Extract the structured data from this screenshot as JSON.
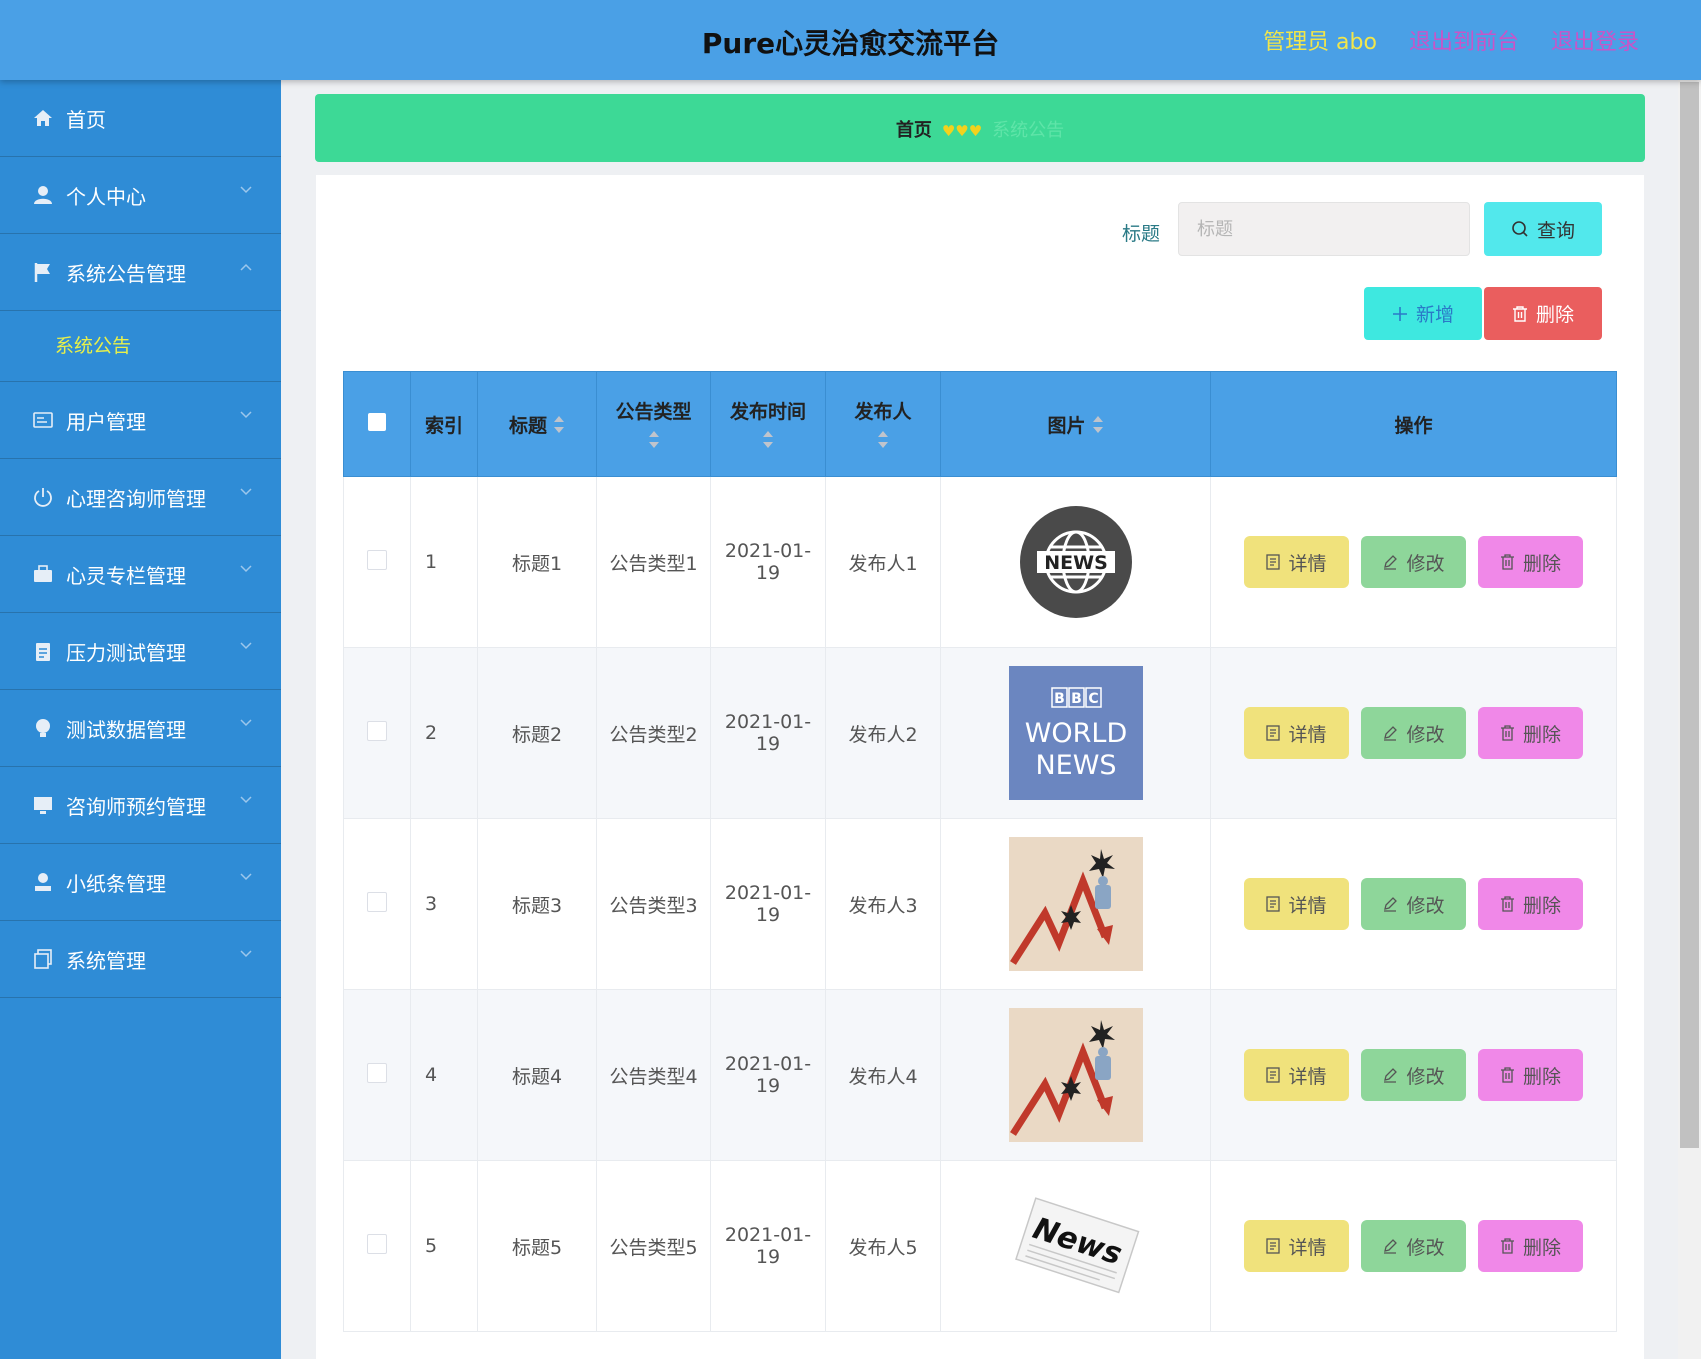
{
  "header": {
    "title": "Pure心灵治愈交流平台",
    "admin_label": "管理员 abo",
    "front_link": "退出到前台",
    "logout_link": "退出登录"
  },
  "sidebar": {
    "items": [
      {
        "label": "首页",
        "icon": "home-icon"
      },
      {
        "label": "个人中心",
        "icon": "user-icon"
      },
      {
        "label": "系统公告管理",
        "icon": "flag-icon",
        "expanded": true
      },
      {
        "label": "用户管理",
        "icon": "id-card-icon"
      },
      {
        "label": "心理咨询师管理",
        "icon": "power-icon"
      },
      {
        "label": "心灵专栏管理",
        "icon": "briefcase-icon"
      },
      {
        "label": "压力测试管理",
        "icon": "clipboard-icon"
      },
      {
        "label": "测试数据管理",
        "icon": "bulb-icon"
      },
      {
        "label": "咨询师预约管理",
        "icon": "monitor-icon"
      },
      {
        "label": "小纸条管理",
        "icon": "person-icon"
      },
      {
        "label": "系统管理",
        "icon": "copy-icon"
      }
    ],
    "sub_item": "系统公告"
  },
  "breadcrumb": {
    "home": "首页",
    "separator": "♥♥♥",
    "current": "系统公告"
  },
  "search": {
    "label": "标题",
    "placeholder": "标题",
    "query_button": "查询"
  },
  "actions": {
    "add_button": "新增",
    "delete_button": "删除"
  },
  "table": {
    "columns": [
      "索引",
      "标题",
      "公告类型",
      "发布时间",
      "发布人",
      "图片",
      "操作"
    ],
    "rows": [
      {
        "index": "1",
        "title": "标题1",
        "type": "公告类型1",
        "time_line1": "2021-01-",
        "time_line2": "19",
        "publisher": "发布人1",
        "image": "news-globe-image"
      },
      {
        "index": "2",
        "title": "标题2",
        "type": "公告类型2",
        "time_line1": "2021-01-",
        "time_line2": "19",
        "publisher": "发布人2",
        "image": "bbc-world-news-image"
      },
      {
        "index": "3",
        "title": "标题3",
        "type": "公告类型3",
        "time_line1": "2021-01-",
        "time_line2": "19",
        "publisher": "发布人3",
        "image": "falling-chart-image"
      },
      {
        "index": "4",
        "title": "标题4",
        "type": "公告类型4",
        "time_line1": "2021-01-",
        "time_line2": "19",
        "publisher": "发布人4",
        "image": "falling-chart-image"
      },
      {
        "index": "5",
        "title": "标题5",
        "type": "公告类型5",
        "time_line1": "2021-01-",
        "time_line2": "19",
        "publisher": "发布人5",
        "image": "newspaper-image"
      }
    ],
    "row_actions": {
      "detail": "详情",
      "edit": "修改",
      "delete": "删除"
    }
  },
  "colors": {
    "header_bg": "#4aa0e6",
    "sidebar_bg": "#2f8cd6",
    "breadcrumb_bg": "#3dd996",
    "query_button": "#52e8ec",
    "add_button": "#3ee8e0",
    "delete_button": "#ea5e5e",
    "detail_button": "#f0e27c",
    "edit_button": "#8ed69a",
    "row_delete_button": "#f088e8"
  }
}
